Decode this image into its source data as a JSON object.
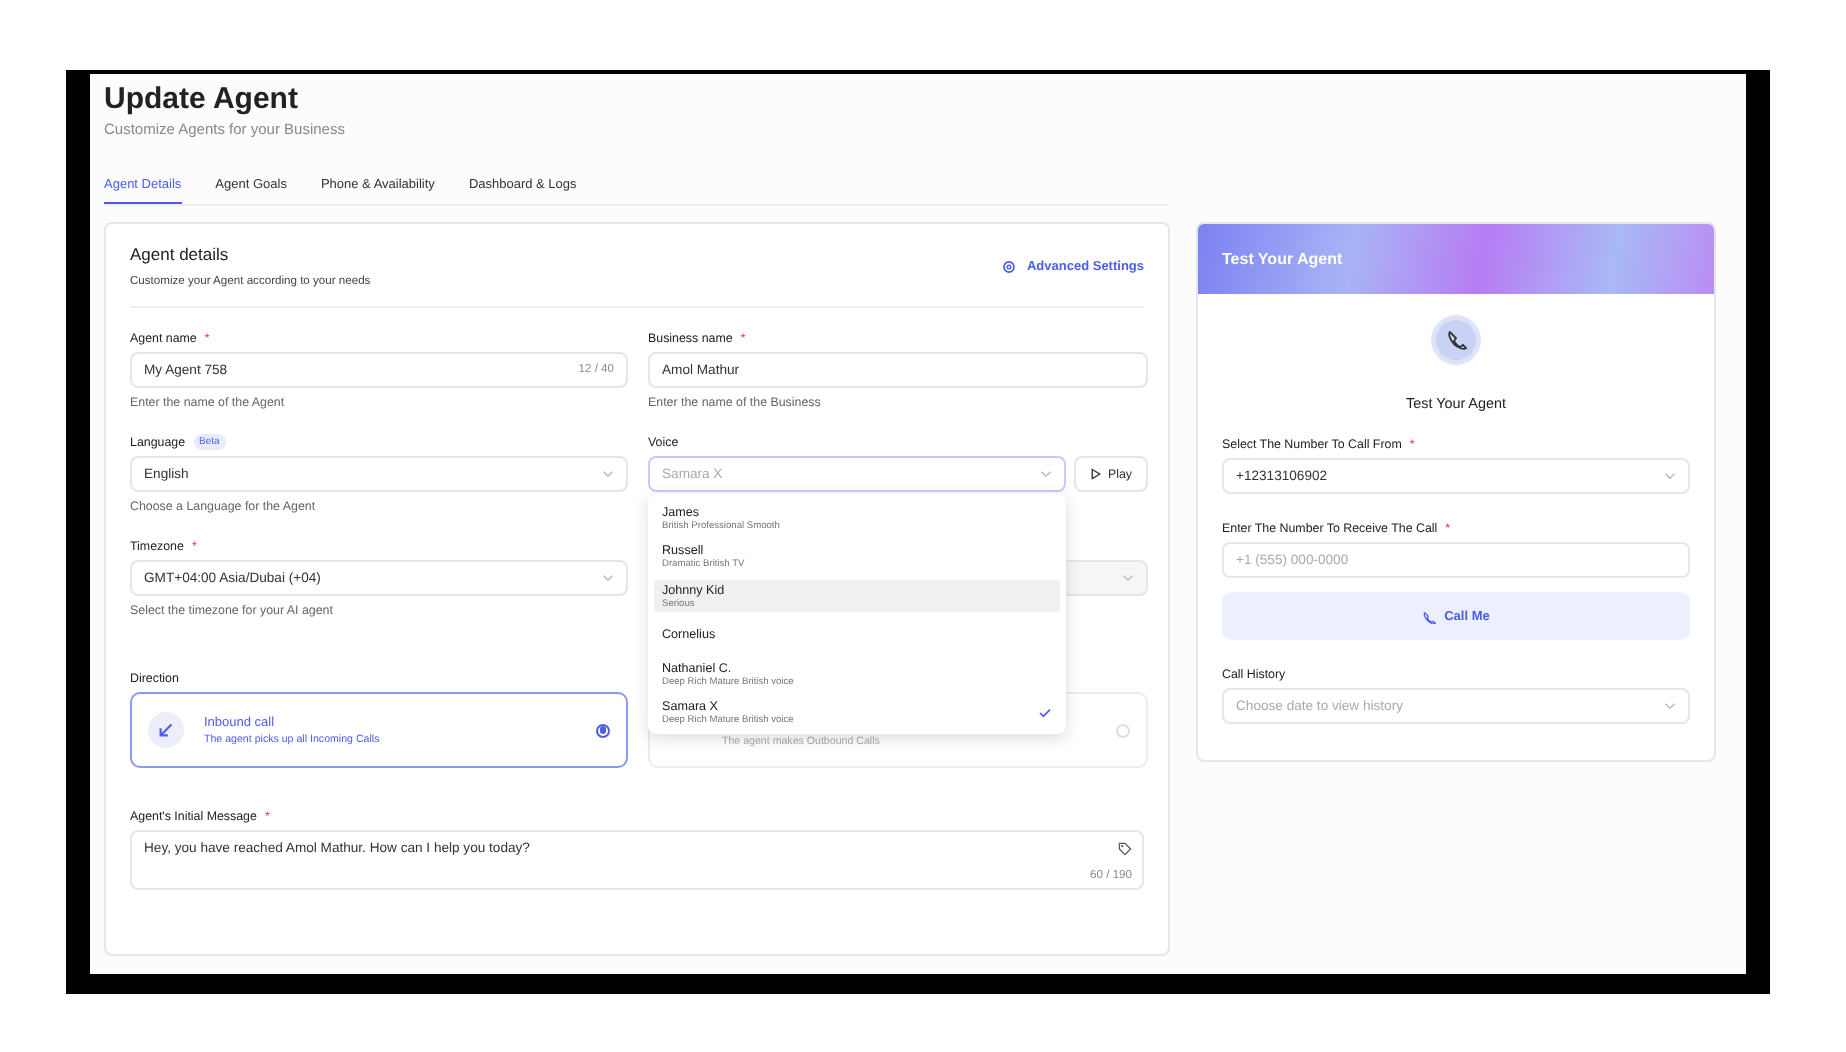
{
  "header": {
    "title": "Update Agent",
    "subtitle": "Customize Agents for your Business"
  },
  "tabs": [
    {
      "label": "Agent Details",
      "selected": true
    },
    {
      "label": "Agent Goals",
      "selected": false
    },
    {
      "label": "Phone & Availability",
      "selected": false
    },
    {
      "label": "Dashboard & Logs",
      "selected": false
    }
  ],
  "details": {
    "title": "Agent details",
    "subtitle": "Customize your Agent according to your needs",
    "advanced_link": "Advanced Settings",
    "agent_name": {
      "label": "Agent name",
      "required_mark": "*",
      "value": "My Agent 758",
      "counter": "12 / 40",
      "help": "Enter the name of the Agent"
    },
    "business_name": {
      "label": "Business name",
      "required_mark": "*",
      "value": "Amol Mathur",
      "help": "Enter the name of the Business"
    },
    "language": {
      "label": "Language",
      "badge": "Beta",
      "value": "English",
      "help": "Choose a Language for the Agent"
    },
    "voice": {
      "label": "Voice",
      "placeholder": "Samara X",
      "play": "Play",
      "options": [
        {
          "name": "James",
          "description": "British Professional Smooth",
          "highlighted": false,
          "selected": false
        },
        {
          "name": "Russell",
          "description": "Dramatic British TV",
          "highlighted": false,
          "selected": false
        },
        {
          "name": "Johnny Kid",
          "description": "Serious",
          "highlighted": true,
          "selected": false
        },
        {
          "name": "Cornelius",
          "highlighted": false,
          "selected": false
        },
        {
          "name": "Nathaniel C.",
          "description": "Deep Rich Mature British voice",
          "highlighted": false,
          "selected": false
        },
        {
          "name": "Samara X",
          "description": "Deep Rich Mature British voice",
          "highlighted": false,
          "selected": true
        }
      ]
    },
    "timezone": {
      "label": "Timezone",
      "required_mark": "*",
      "value": "GMT+04:00 Asia/Dubai (+04)",
      "help": "Select the timezone for your AI agent"
    },
    "direction": {
      "label": "Direction",
      "options": [
        {
          "kind": "inbound",
          "title": "Inbound call",
          "description": "The agent picks up all Incoming Calls",
          "selected": true
        },
        {
          "kind": "outbound",
          "description": "The agent makes Outbound Calls",
          "selected": false
        }
      ]
    },
    "initial_message": {
      "label": "Agent's Initial Message",
      "required_mark": "*",
      "value": "Hey, you have reached Amol Mathur. How can I help you today?",
      "counter": "60 / 190"
    }
  },
  "test_panel": {
    "header": "Test Your Agent",
    "title": "Test Your Agent",
    "from": {
      "label": "Select The Number To Call From",
      "required_mark": "*",
      "value": "+12313106902"
    },
    "to": {
      "label": "Enter The Number To Receive The Call",
      "required_mark": "*",
      "placeholder": "+1 (555) 000-0000"
    },
    "call_button": "Call Me",
    "history": {
      "label": "Call History",
      "placeholder": "Choose date to view history"
    }
  }
}
